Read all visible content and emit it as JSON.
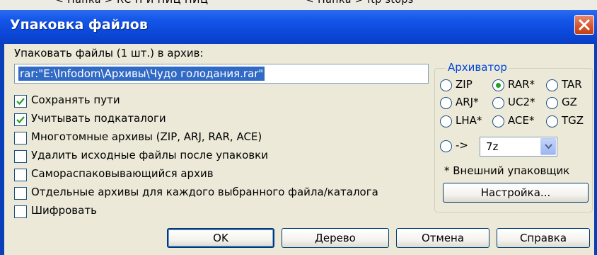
{
  "window": {
    "title": "Упаковка файлов",
    "behind_text_left": "< Папка >   КС Н   И НИЦ НИЦ",
    "behind_text_right": "< Папка > ftp stops"
  },
  "main": {
    "pack_label": "Упаковать файлы (1 шт.) в архив:",
    "archive_path": "rar:\"E:\\Infodom\\Архивы\\Чудо голодания.rar\""
  },
  "options": [
    {
      "label": "Сохранять пути",
      "checked": true
    },
    {
      "label": "Учитывать подкаталоги",
      "checked": true
    },
    {
      "label": "Многотомные архивы (ZIP, ARJ, RAR, ACE)",
      "checked": false
    },
    {
      "label": "Удалить исходные файлы после упаковки",
      "checked": false
    },
    {
      "label": "Самораспаковывающийся архив",
      "checked": false
    },
    {
      "label": "Отдельные архивы для каждого выбранного файла/каталога",
      "checked": false
    },
    {
      "label": "Шифровать",
      "checked": false
    }
  ],
  "archiver": {
    "group_title": "Архиватор",
    "formats": [
      {
        "label": "ZIP",
        "selected": false
      },
      {
        "label": "RAR*",
        "selected": true
      },
      {
        "label": "TAR",
        "selected": false
      },
      {
        "label": "ARJ*",
        "selected": false
      },
      {
        "label": "UC2*",
        "selected": false
      },
      {
        "label": "GZ",
        "selected": false
      },
      {
        "label": "LHA*",
        "selected": false
      },
      {
        "label": "ACE*",
        "selected": false
      },
      {
        "label": "TGZ",
        "selected": false
      }
    ],
    "custom_arrow": "->",
    "custom_value": "7z",
    "note": "* Внешний упаковщик",
    "settings_button": "Настройка..."
  },
  "buttons": {
    "ok": "OK",
    "tree": "Дерево",
    "cancel": "Отмена",
    "help": "Справка"
  },
  "colors": {
    "title_bar": "#0b47d8",
    "selection": "#316ac5",
    "group_title": "#0046d5",
    "radio_dot": "#21a121",
    "dialog_bg": "#ece9d8"
  }
}
